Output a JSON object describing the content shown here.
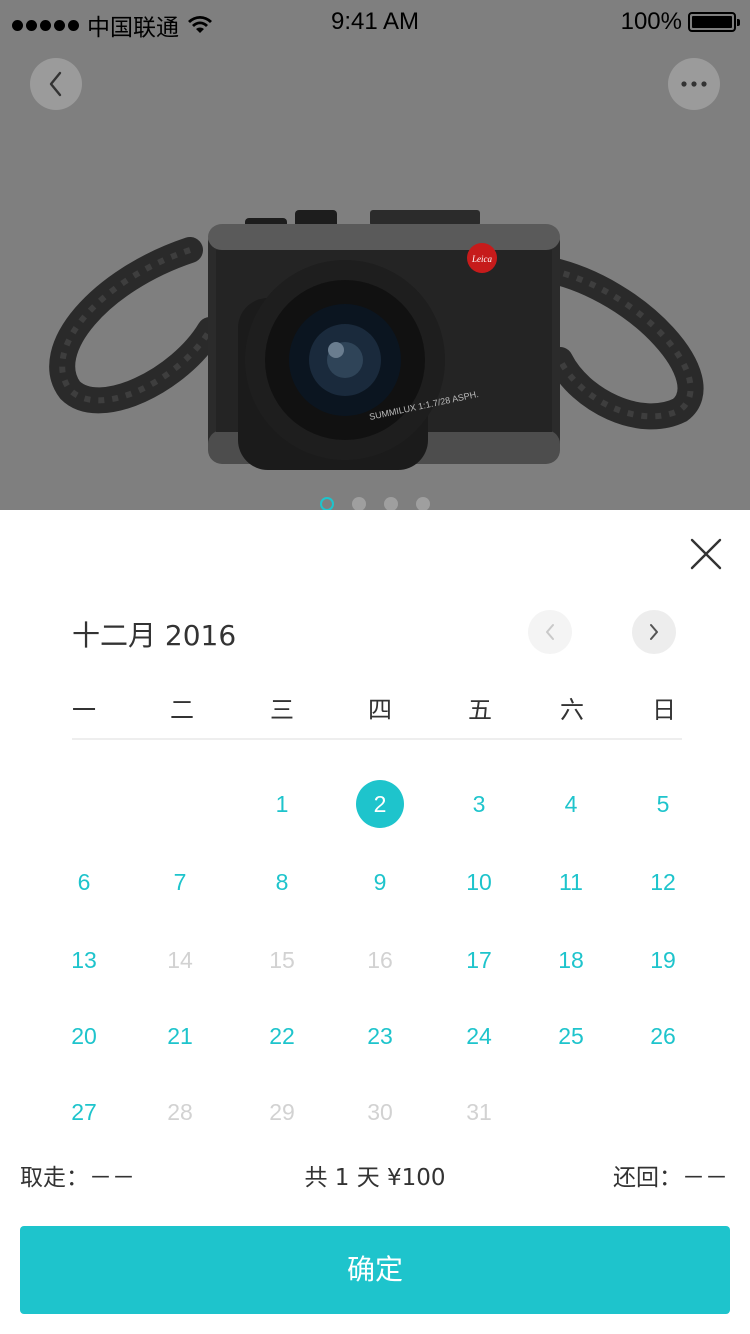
{
  "status_bar": {
    "carrier": "中国联通",
    "time": "9:41 AM",
    "battery": "100%"
  },
  "hero": {
    "lens_text": "SUMMILUX 1:1.7/28 ASPH.",
    "brand_text": "Leica",
    "carousel": {
      "count": 4,
      "active_index": 0
    }
  },
  "calendar": {
    "month_title": "十二月 2016",
    "weekdays": [
      "一",
      "二",
      "三",
      "四",
      "五",
      "六",
      "日"
    ],
    "rows": [
      [
        null,
        null,
        {
          "d": "1",
          "s": "active"
        },
        {
          "d": "2",
          "s": "selected"
        },
        {
          "d": "3",
          "s": "active"
        },
        {
          "d": "4",
          "s": "active"
        },
        {
          "d": "5",
          "s": "active"
        }
      ],
      [
        {
          "d": "6",
          "s": "active"
        },
        {
          "d": "7",
          "s": "active"
        },
        {
          "d": "8",
          "s": "active"
        },
        {
          "d": "9",
          "s": "active"
        },
        {
          "d": "10",
          "s": "active"
        },
        {
          "d": "11",
          "s": "active"
        },
        {
          "d": "12",
          "s": "active"
        }
      ],
      [
        {
          "d": "13",
          "s": "active"
        },
        {
          "d": "14",
          "s": "disabled"
        },
        {
          "d": "15",
          "s": "disabled"
        },
        {
          "d": "16",
          "s": "disabled"
        },
        {
          "d": "17",
          "s": "active"
        },
        {
          "d": "18",
          "s": "active"
        },
        {
          "d": "19",
          "s": "active"
        }
      ],
      [
        {
          "d": "20",
          "s": "active"
        },
        {
          "d": "21",
          "s": "active"
        },
        {
          "d": "22",
          "s": "active"
        },
        {
          "d": "23",
          "s": "active"
        },
        {
          "d": "24",
          "s": "active"
        },
        {
          "d": "25",
          "s": "active"
        },
        {
          "d": "26",
          "s": "active"
        }
      ],
      [
        {
          "d": "27",
          "s": "active"
        },
        {
          "d": "28",
          "s": "disabled"
        },
        {
          "d": "29",
          "s": "disabled"
        },
        {
          "d": "30",
          "s": "disabled"
        },
        {
          "d": "31",
          "s": "disabled"
        },
        null,
        null
      ]
    ]
  },
  "summary": {
    "pickup": "取走：－－",
    "total": "共 1 天 ¥100",
    "return": "还回：－－"
  },
  "confirm_label": "确定",
  "colors": {
    "accent": "#1ec4cc",
    "disabled": "#d2d2d2",
    "hero_bg": "#7f7f7f"
  }
}
